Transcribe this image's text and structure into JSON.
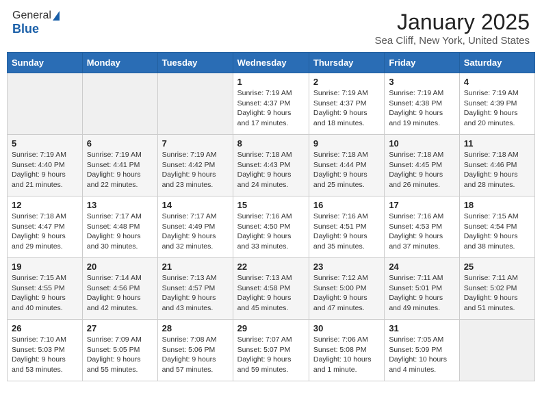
{
  "header": {
    "logo_general": "General",
    "logo_blue": "Blue",
    "month": "January 2025",
    "location": "Sea Cliff, New York, United States"
  },
  "weekdays": [
    "Sunday",
    "Monday",
    "Tuesday",
    "Wednesday",
    "Thursday",
    "Friday",
    "Saturday"
  ],
  "weeks": [
    [
      {
        "day": "",
        "info": ""
      },
      {
        "day": "",
        "info": ""
      },
      {
        "day": "",
        "info": ""
      },
      {
        "day": "1",
        "info": "Sunrise: 7:19 AM\nSunset: 4:37 PM\nDaylight: 9 hours\nand 17 minutes."
      },
      {
        "day": "2",
        "info": "Sunrise: 7:19 AM\nSunset: 4:37 PM\nDaylight: 9 hours\nand 18 minutes."
      },
      {
        "day": "3",
        "info": "Sunrise: 7:19 AM\nSunset: 4:38 PM\nDaylight: 9 hours\nand 19 minutes."
      },
      {
        "day": "4",
        "info": "Sunrise: 7:19 AM\nSunset: 4:39 PM\nDaylight: 9 hours\nand 20 minutes."
      }
    ],
    [
      {
        "day": "5",
        "info": "Sunrise: 7:19 AM\nSunset: 4:40 PM\nDaylight: 9 hours\nand 21 minutes."
      },
      {
        "day": "6",
        "info": "Sunrise: 7:19 AM\nSunset: 4:41 PM\nDaylight: 9 hours\nand 22 minutes."
      },
      {
        "day": "7",
        "info": "Sunrise: 7:19 AM\nSunset: 4:42 PM\nDaylight: 9 hours\nand 23 minutes."
      },
      {
        "day": "8",
        "info": "Sunrise: 7:18 AM\nSunset: 4:43 PM\nDaylight: 9 hours\nand 24 minutes."
      },
      {
        "day": "9",
        "info": "Sunrise: 7:18 AM\nSunset: 4:44 PM\nDaylight: 9 hours\nand 25 minutes."
      },
      {
        "day": "10",
        "info": "Sunrise: 7:18 AM\nSunset: 4:45 PM\nDaylight: 9 hours\nand 26 minutes."
      },
      {
        "day": "11",
        "info": "Sunrise: 7:18 AM\nSunset: 4:46 PM\nDaylight: 9 hours\nand 28 minutes."
      }
    ],
    [
      {
        "day": "12",
        "info": "Sunrise: 7:18 AM\nSunset: 4:47 PM\nDaylight: 9 hours\nand 29 minutes."
      },
      {
        "day": "13",
        "info": "Sunrise: 7:17 AM\nSunset: 4:48 PM\nDaylight: 9 hours\nand 30 minutes."
      },
      {
        "day": "14",
        "info": "Sunrise: 7:17 AM\nSunset: 4:49 PM\nDaylight: 9 hours\nand 32 minutes."
      },
      {
        "day": "15",
        "info": "Sunrise: 7:16 AM\nSunset: 4:50 PM\nDaylight: 9 hours\nand 33 minutes."
      },
      {
        "day": "16",
        "info": "Sunrise: 7:16 AM\nSunset: 4:51 PM\nDaylight: 9 hours\nand 35 minutes."
      },
      {
        "day": "17",
        "info": "Sunrise: 7:16 AM\nSunset: 4:53 PM\nDaylight: 9 hours\nand 37 minutes."
      },
      {
        "day": "18",
        "info": "Sunrise: 7:15 AM\nSunset: 4:54 PM\nDaylight: 9 hours\nand 38 minutes."
      }
    ],
    [
      {
        "day": "19",
        "info": "Sunrise: 7:15 AM\nSunset: 4:55 PM\nDaylight: 9 hours\nand 40 minutes."
      },
      {
        "day": "20",
        "info": "Sunrise: 7:14 AM\nSunset: 4:56 PM\nDaylight: 9 hours\nand 42 minutes."
      },
      {
        "day": "21",
        "info": "Sunrise: 7:13 AM\nSunset: 4:57 PM\nDaylight: 9 hours\nand 43 minutes."
      },
      {
        "day": "22",
        "info": "Sunrise: 7:13 AM\nSunset: 4:58 PM\nDaylight: 9 hours\nand 45 minutes."
      },
      {
        "day": "23",
        "info": "Sunrise: 7:12 AM\nSunset: 5:00 PM\nDaylight: 9 hours\nand 47 minutes."
      },
      {
        "day": "24",
        "info": "Sunrise: 7:11 AM\nSunset: 5:01 PM\nDaylight: 9 hours\nand 49 minutes."
      },
      {
        "day": "25",
        "info": "Sunrise: 7:11 AM\nSunset: 5:02 PM\nDaylight: 9 hours\nand 51 minutes."
      }
    ],
    [
      {
        "day": "26",
        "info": "Sunrise: 7:10 AM\nSunset: 5:03 PM\nDaylight: 9 hours\nand 53 minutes."
      },
      {
        "day": "27",
        "info": "Sunrise: 7:09 AM\nSunset: 5:05 PM\nDaylight: 9 hours\nand 55 minutes."
      },
      {
        "day": "28",
        "info": "Sunrise: 7:08 AM\nSunset: 5:06 PM\nDaylight: 9 hours\nand 57 minutes."
      },
      {
        "day": "29",
        "info": "Sunrise: 7:07 AM\nSunset: 5:07 PM\nDaylight: 9 hours\nand 59 minutes."
      },
      {
        "day": "30",
        "info": "Sunrise: 7:06 AM\nSunset: 5:08 PM\nDaylight: 10 hours\nand 1 minute."
      },
      {
        "day": "31",
        "info": "Sunrise: 7:05 AM\nSunset: 5:09 PM\nDaylight: 10 hours\nand 4 minutes."
      },
      {
        "day": "",
        "info": ""
      }
    ]
  ]
}
